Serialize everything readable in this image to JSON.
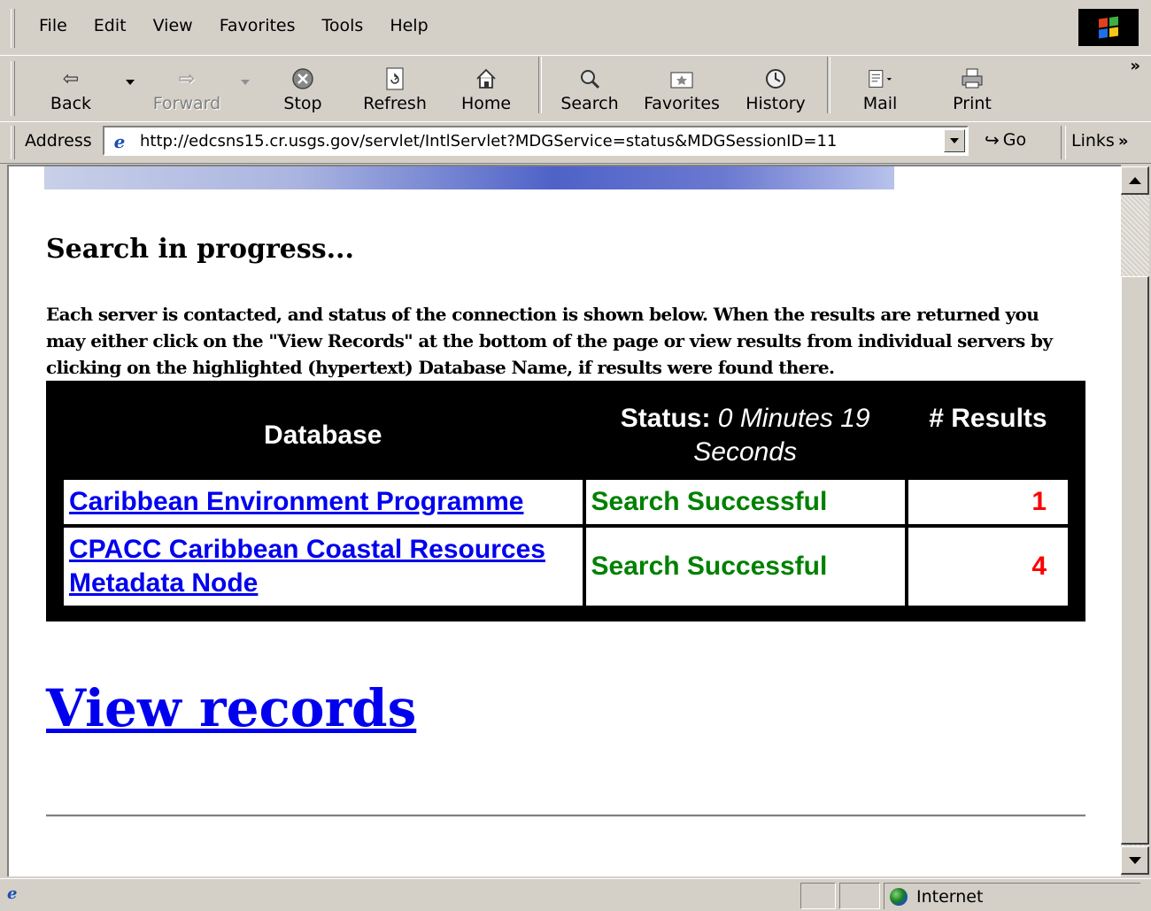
{
  "menu": {
    "items": [
      "File",
      "Edit",
      "View",
      "Favorites",
      "Tools",
      "Help"
    ]
  },
  "toolbar": {
    "back": "Back",
    "forward": "Forward",
    "stop": "Stop",
    "refresh": "Refresh",
    "home": "Home",
    "search": "Search",
    "favorites": "Favorites",
    "history": "History",
    "mail": "Mail",
    "print": "Print",
    "more": "»"
  },
  "address": {
    "label": "Address",
    "url": "http://edcsns15.cr.usgs.gov/servlet/IntlServlet?MDGService=status&MDGSessionID=11",
    "go": "Go",
    "links": "Links",
    "links_more": "»"
  },
  "page": {
    "title": "Search in progress...",
    "intro": "Each server is contacted, and status of the connection is shown below. When the results are returned you may either click on the \"View Records\" at the bottom of the page or view results from individual servers by clicking on the highlighted (hypertext) Database Name, if results were found there.",
    "table": {
      "col_database": "Database",
      "col_status_prefix": "Status:",
      "col_status_time": "0 Minutes 19 Seconds",
      "col_results": "# Results",
      "rows": [
        {
          "database": "Caribbean Environment Programme",
          "status": "Search Successful",
          "results": "1"
        },
        {
          "database": "CPACC Caribbean Coastal Resources Metadata Node",
          "status": "Search Successful",
          "results": "4"
        }
      ]
    },
    "view_records": "View records"
  },
  "statusbar": {
    "zone": "Internet"
  },
  "colors": {
    "link": "#0000ee",
    "success": "#008000",
    "count": "#ff0000",
    "chrome": "#d4d0c8"
  }
}
